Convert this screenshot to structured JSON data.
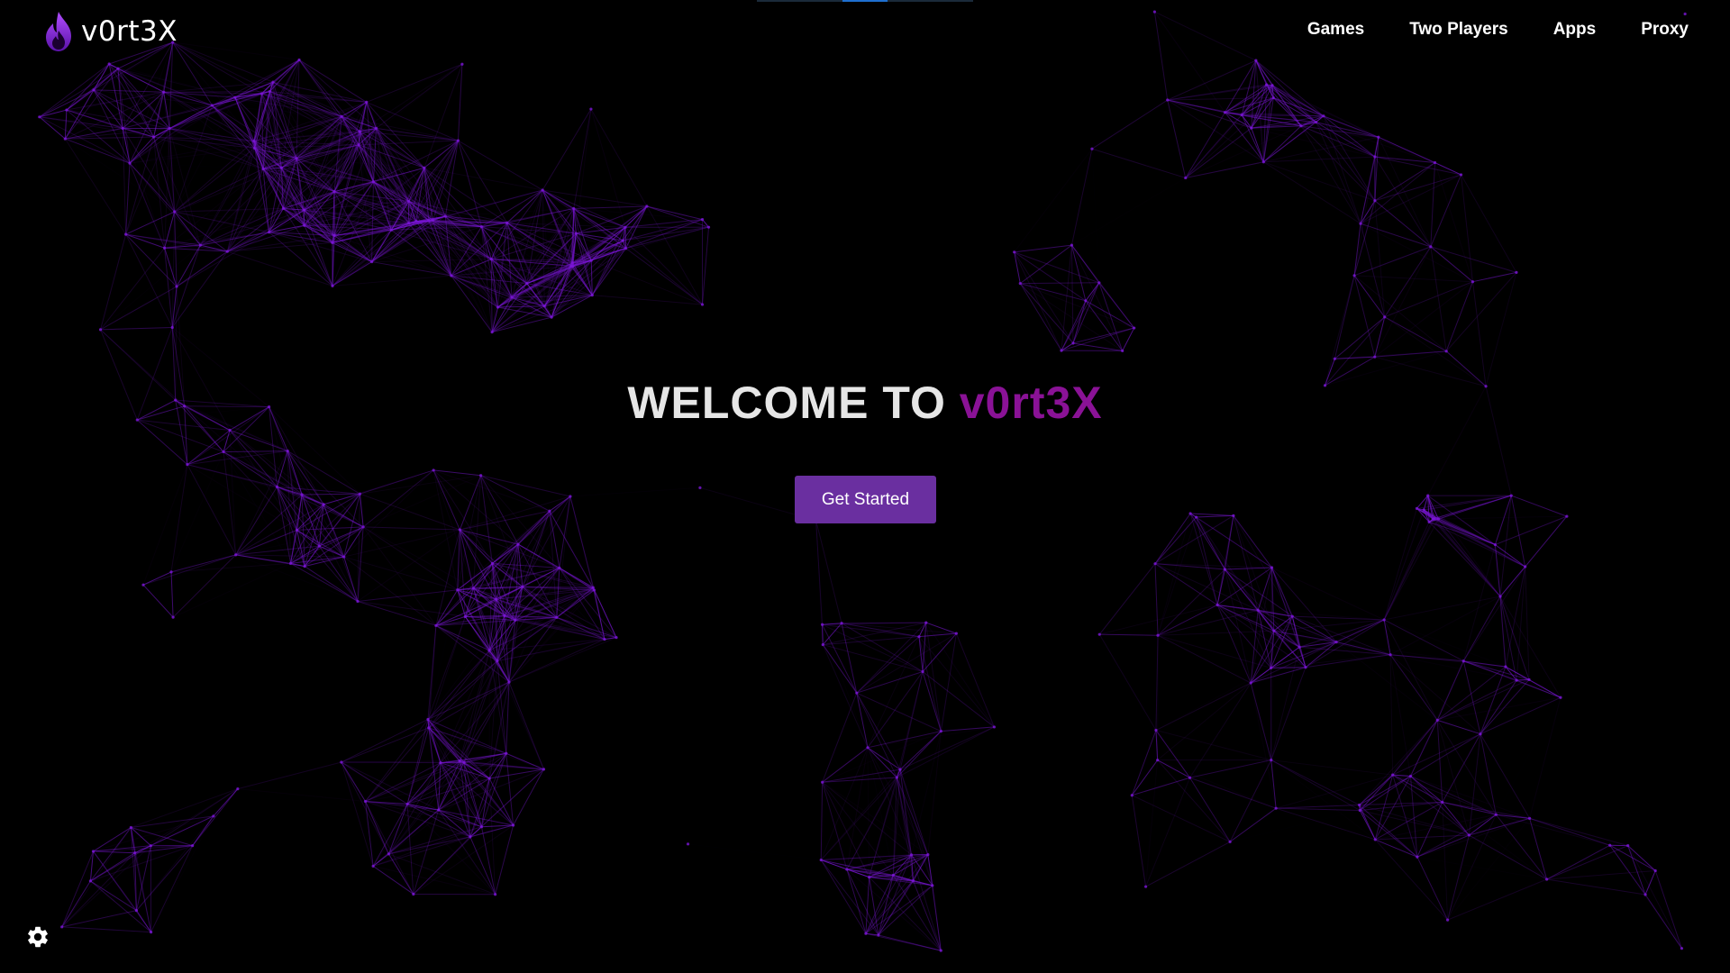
{
  "header": {
    "brand": "v0rt3X",
    "nav": [
      "Games",
      "Two Players",
      "Apps",
      "Proxy"
    ]
  },
  "hero": {
    "welcome": "WELCOME TO ",
    "name": "v0rt3X",
    "cta": "Get Started"
  },
  "icons": {
    "logo": "flame-icon",
    "settings": "gear-icon"
  },
  "colors": {
    "background": "#000000",
    "accent": "#6a2fa0",
    "brand_highlight": "#8a1296",
    "network_lines": "#7a16d6"
  }
}
